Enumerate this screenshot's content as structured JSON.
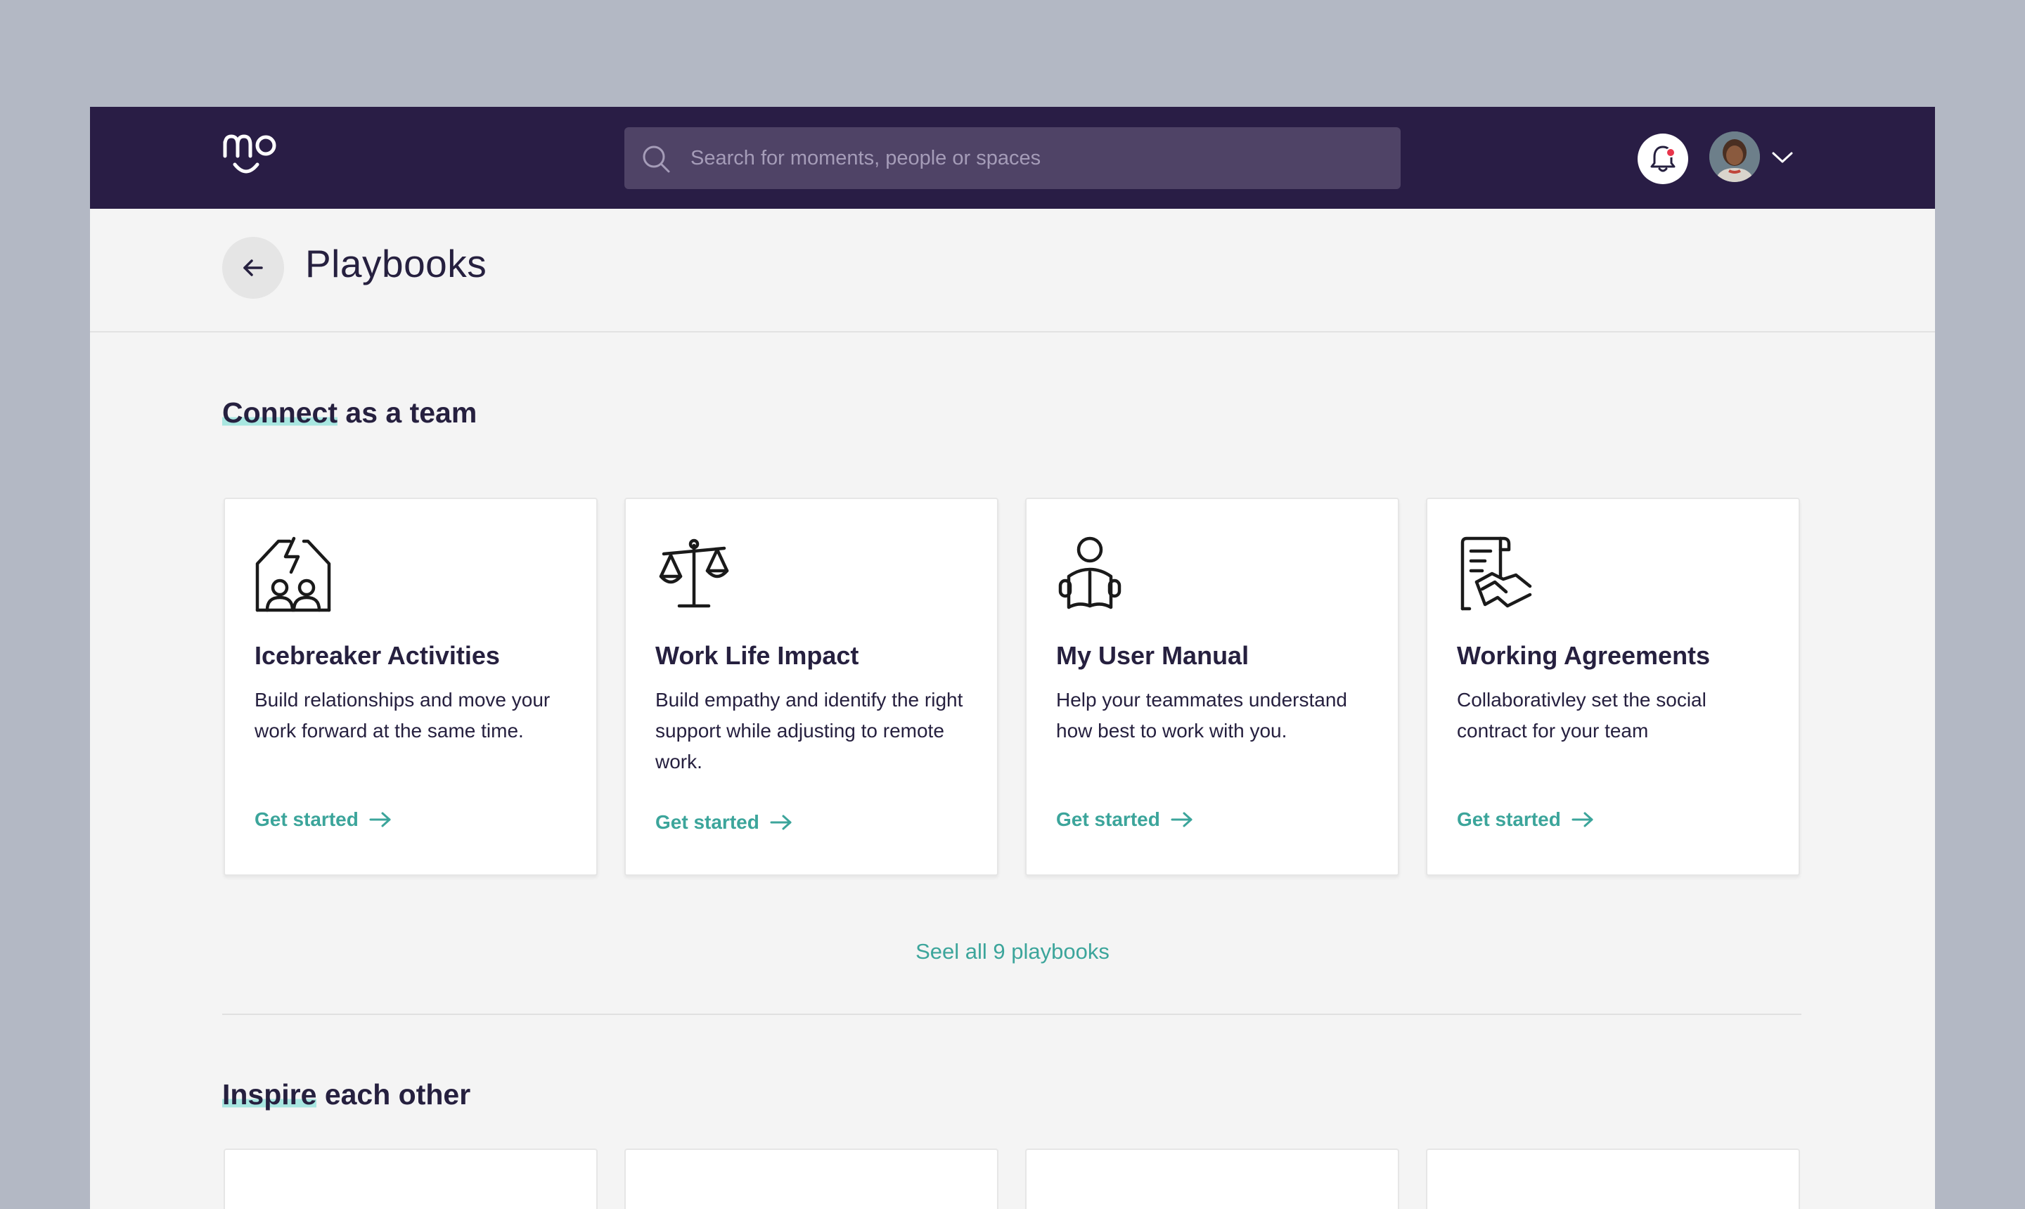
{
  "header": {
    "logo_text": "mo",
    "search_placeholder": "Search for moments, people or spaces",
    "notification_dot_color": "#e8354b"
  },
  "page": {
    "title": "Playbooks"
  },
  "section1": {
    "heading_highlight": "Connect",
    "heading_rest": " as a team",
    "cards": [
      {
        "icon": "lightning-house-people-icon",
        "title": "Icebreaker Activities",
        "description": "Build relationships and move your work forward at the same time.",
        "cta": "Get started"
      },
      {
        "icon": "scales-icon",
        "title": "Work Life Impact",
        "description": "Build empathy and identify the right support while adjusting to remote work.",
        "cta": "Get started"
      },
      {
        "icon": "person-reading-book-icon",
        "title": "My User Manual",
        "description": "Help your teammates understand how best to work with you.",
        "cta": "Get started"
      },
      {
        "icon": "document-handshake-icon",
        "title": "Working Agreements",
        "description": "Collaborativley set the social contract for your team",
        "cta": "Get started"
      }
    ],
    "see_all": "Seel all 9 playbooks"
  },
  "section2": {
    "heading_highlight": "Inspire",
    "heading_rest": " each other"
  },
  "colors": {
    "topbar": "#291d45",
    "accent": "#3ca59b",
    "highlight": "#a8e6e0",
    "text": "#26203f"
  }
}
